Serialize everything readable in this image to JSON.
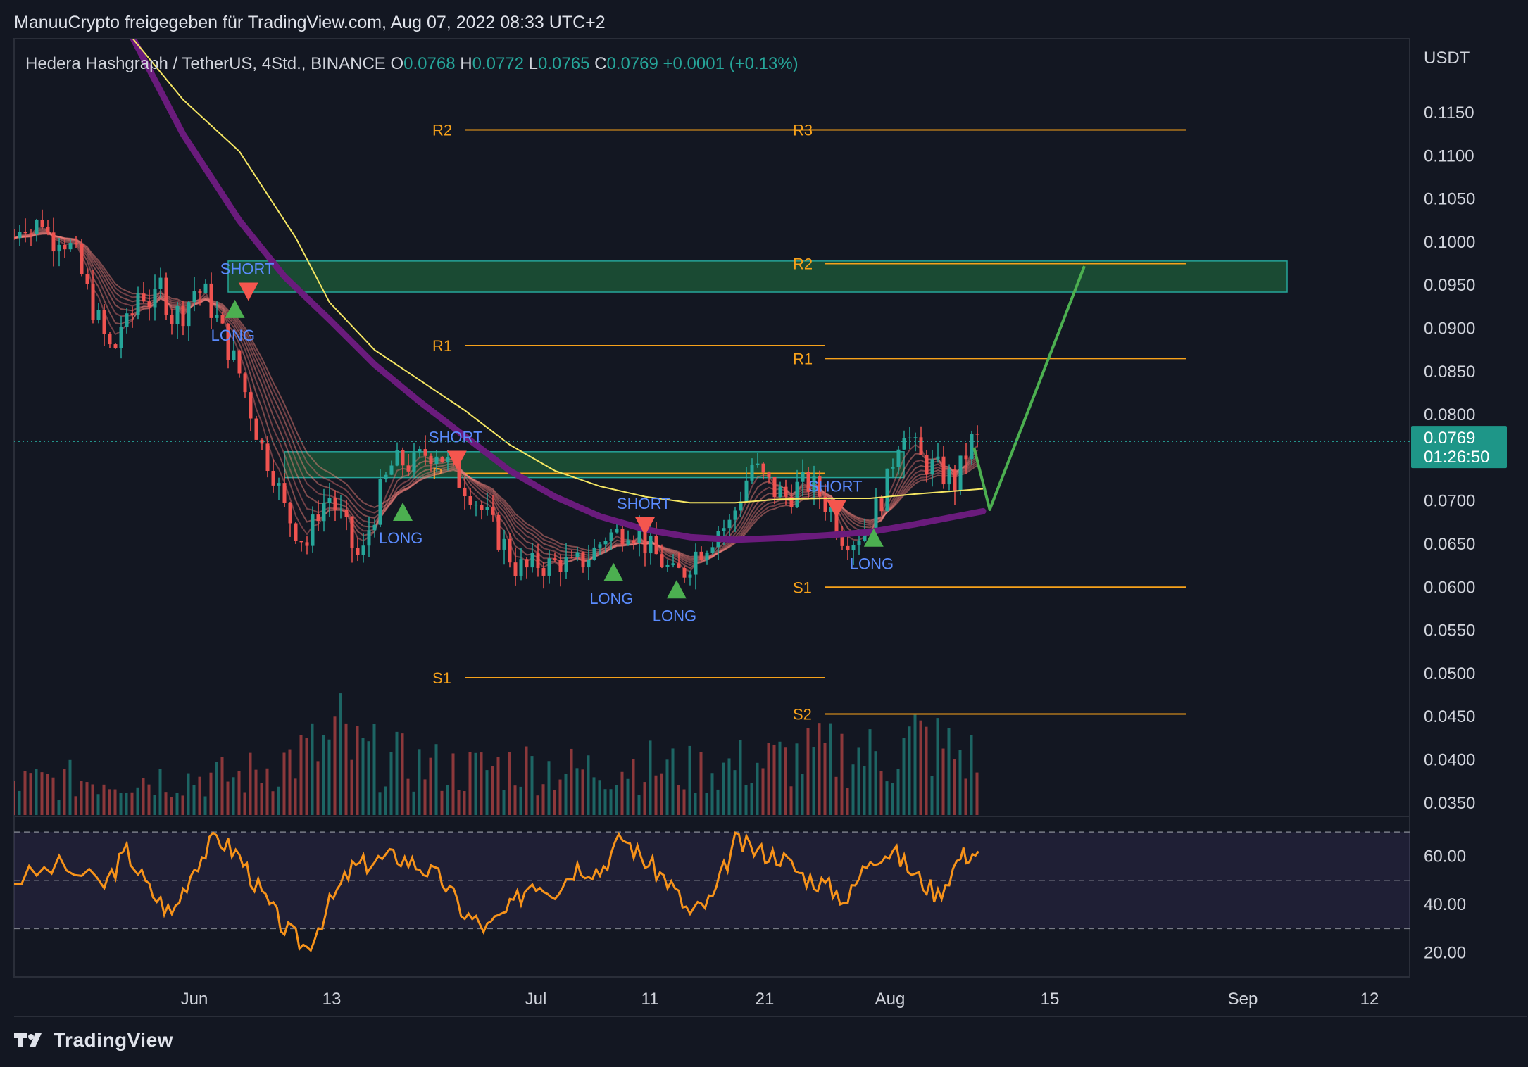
{
  "header": {
    "attribution": "ManuuCrypto freigegeben für TradingView.com, Aug 07, 2022 08:33 UTC+2"
  },
  "legend": {
    "symbol": "Hedera Hashgraph / TetherUS, 4Std., BINANCE",
    "o_key": "O",
    "o": "0.0768",
    "h_key": "H",
    "h": "0.0772",
    "l_key": "L",
    "l": "0.0765",
    "c_key": "C",
    "c": "0.0769",
    "change": "+0.0001 (+0.13%)"
  },
  "price_axis": {
    "currency": "USDT",
    "labels": [
      "0.1150",
      "0.1100",
      "0.1050",
      "0.1000",
      "0.0950",
      "0.0900",
      "0.0850",
      "0.0800",
      "0.0700",
      "0.0650",
      "0.0600",
      "0.0550",
      "0.0500",
      "0.0450",
      "0.0400",
      "0.0350"
    ],
    "current_price": "0.0769",
    "countdown": "01:26:50"
  },
  "rsi_axis": {
    "labels": [
      "60.00",
      "40.00",
      "20.00"
    ]
  },
  "time_axis": {
    "labels": [
      "Jun",
      "13",
      "Jul",
      "11",
      "21",
      "Aug",
      "15",
      "Sep",
      "12"
    ]
  },
  "colors": {
    "background": "#131722",
    "up": "#26a69a",
    "down": "#ef5350",
    "pivot": "#f7a21b",
    "zone": "#1e5c3a",
    "sma": "#f5e663",
    "ema": "#6a1b7c",
    "rsi": "#f7931a",
    "projection": "#4caf50",
    "signal_text": "#5b8cff"
  },
  "footer": {
    "brand": "TradingView",
    "logo_icon": "tradingview-logo-icon"
  },
  "chart_data": {
    "type": "candlestick",
    "symbol": "HBAR/USDT",
    "timeframe": "4Std.",
    "exchange": "BINANCE",
    "ylim": [
      0.0335,
      0.122
    ],
    "price_path": [
      [
        0.0,
        0.1005
      ],
      [
        0.8,
        0.103
      ],
      [
        1.6,
        0.101
      ],
      [
        2.4,
        0.103
      ],
      [
        3.2,
        0.1002
      ],
      [
        4.0,
        0.101
      ],
      [
        4.8,
        0.0998
      ],
      [
        5.6,
        0.0978
      ],
      [
        6.4,
        0.0945
      ],
      [
        7.2,
        0.0918
      ],
      [
        8.0,
        0.089
      ],
      [
        8.8,
        0.0868
      ],
      [
        9.5,
        0.0905
      ],
      [
        10.2,
        0.09
      ],
      [
        11.0,
        0.0942
      ],
      [
        11.6,
        0.094
      ],
      [
        12.4,
        0.0925
      ],
      [
        13.0,
        0.095
      ],
      [
        14.0,
        0.0915
      ],
      [
        15.0,
        0.092
      ],
      [
        16.0,
        0.0945
      ],
      [
        17.0,
        0.0938
      ],
      [
        18.0,
        0.091
      ],
      [
        19.0,
        0.0878
      ],
      [
        20.0,
        0.0848
      ],
      [
        21.0,
        0.0805
      ],
      [
        22.0,
        0.0762
      ],
      [
        23.0,
        0.0735
      ],
      [
        24.0,
        0.069
      ],
      [
        25.0,
        0.0668
      ],
      [
        26.0,
        0.065
      ],
      [
        27.0,
        0.069
      ],
      [
        28.0,
        0.0705
      ],
      [
        29.0,
        0.068
      ],
      [
        30.0,
        0.0648
      ],
      [
        30.8,
        0.0628
      ],
      [
        31.5,
        0.0668
      ],
      [
        32.5,
        0.0708
      ],
      [
        33.5,
        0.074
      ],
      [
        34.5,
        0.0745
      ],
      [
        35.5,
        0.0742
      ],
      [
        36.5,
        0.0755
      ],
      [
        37.5,
        0.076
      ],
      [
        38.5,
        0.0742
      ],
      [
        39.5,
        0.0725
      ],
      [
        40.5,
        0.0712
      ],
      [
        41.5,
        0.069
      ],
      [
        42.5,
        0.0668
      ],
      [
        43.5,
        0.0648
      ],
      [
        44.5,
        0.0625
      ],
      [
        45.5,
        0.062
      ],
      [
        46.5,
        0.0628
      ],
      [
        47.5,
        0.0625
      ],
      [
        48.5,
        0.063
      ],
      [
        49.5,
        0.0622
      ],
      [
        50.5,
        0.0632
      ],
      [
        51.5,
        0.0642
      ],
      [
        52.5,
        0.066
      ],
      [
        53.5,
        0.0662
      ],
      [
        54.5,
        0.0672
      ],
      [
        55.5,
        0.066
      ],
      [
        56.5,
        0.0642
      ],
      [
        57.5,
        0.063
      ],
      [
        58.5,
        0.0612
      ],
      [
        59.5,
        0.062
      ],
      [
        60.5,
        0.064
      ],
      [
        61.5,
        0.0652
      ],
      [
        62.5,
        0.0668
      ],
      [
        63.5,
        0.0672
      ],
      [
        64.5,
        0.0708
      ],
      [
        65.5,
        0.0742
      ],
      [
        66.5,
        0.0725
      ],
      [
        67.5,
        0.0712
      ],
      [
        68.5,
        0.0705
      ],
      [
        69.5,
        0.0715
      ],
      [
        70.5,
        0.072
      ],
      [
        71.5,
        0.0708
      ],
      [
        72.5,
        0.069
      ],
      [
        73.5,
        0.0662
      ],
      [
        74.5,
        0.0658
      ],
      [
        75.5,
        0.0668
      ],
      [
        76.5,
        0.069
      ],
      [
        77.5,
        0.072
      ],
      [
        78.2,
        0.076
      ],
      [
        78.9,
        0.079
      ],
      [
        79.6,
        0.0768
      ],
      [
        80.4,
        0.0748
      ],
      [
        81.2,
        0.0742
      ],
      [
        82.0,
        0.0735
      ],
      [
        82.8,
        0.0728
      ],
      [
        83.6,
        0.072
      ],
      [
        84.2,
        0.0745
      ],
      [
        84.8,
        0.0765
      ],
      [
        85.2,
        0.0772
      ],
      [
        85.6,
        0.0769
      ]
    ],
    "volume_profile": [
      [
        0,
        0.025
      ],
      [
        10,
        0.03
      ],
      [
        20,
        0.03
      ],
      [
        28,
        0.055
      ],
      [
        29,
        0.065
      ],
      [
        30,
        0.05
      ],
      [
        35,
        0.04
      ],
      [
        40,
        0.035
      ],
      [
        45,
        0.04
      ],
      [
        50,
        0.035
      ],
      [
        55,
        0.04
      ],
      [
        60,
        0.035
      ],
      [
        65,
        0.04
      ],
      [
        70,
        0.045
      ],
      [
        74,
        0.05
      ],
      [
        78,
        0.045
      ],
      [
        80,
        0.06
      ],
      [
        85,
        0.045
      ]
    ],
    "pivot_levels": [
      {
        "label": "R2",
        "value": 0.113,
        "x_start": 40,
        "x_end": 72
      },
      {
        "label": "R1",
        "value": 0.088,
        "x_start": 40,
        "x_end": 72
      },
      {
        "label": "P",
        "value": 0.0732,
        "x_start": 40,
        "x_end": 72
      },
      {
        "label": "S1",
        "value": 0.0495,
        "x_start": 40,
        "x_end": 72
      },
      {
        "label": "R3",
        "value": 0.113,
        "x_start": 72,
        "x_end": 104
      },
      {
        "label": "R2",
        "value": 0.0975,
        "x_start": 72,
        "x_end": 104
      },
      {
        "label": "R1",
        "value": 0.0865,
        "x_start": 72,
        "x_end": 104
      },
      {
        "label": "S1",
        "value": 0.06,
        "x_start": 72,
        "x_end": 104
      },
      {
        "label": "S2",
        "value": 0.0453,
        "x_start": 72,
        "x_end": 104
      }
    ],
    "zones": [
      {
        "low": 0.0942,
        "high": 0.0978,
        "x_start": 19,
        "x_end": 113
      },
      {
        "low": 0.0727,
        "high": 0.0757,
        "x_start": 24,
        "x_end": 79
      }
    ],
    "sma_path": [
      [
        9,
        0.126
      ],
      [
        15,
        0.1165
      ],
      [
        20,
        0.1105
      ],
      [
        25,
        0.1005
      ],
      [
        28,
        0.093
      ],
      [
        32,
        0.0875
      ],
      [
        36,
        0.084
      ],
      [
        40,
        0.0805
      ],
      [
        44,
        0.0765
      ],
      [
        48,
        0.0735
      ],
      [
        52,
        0.0717
      ],
      [
        56,
        0.0705
      ],
      [
        60,
        0.0698
      ],
      [
        64,
        0.0698
      ],
      [
        68,
        0.0702
      ],
      [
        72,
        0.0703
      ],
      [
        76,
        0.0703
      ],
      [
        80,
        0.0708
      ],
      [
        84,
        0.0712
      ],
      [
        86,
        0.0714
      ]
    ],
    "ema_path": [
      [
        10,
        0.125
      ],
      [
        15,
        0.1125
      ],
      [
        20,
        0.1025
      ],
      [
        24,
        0.096
      ],
      [
        28,
        0.091
      ],
      [
        32,
        0.0858
      ],
      [
        36,
        0.0815
      ],
      [
        40,
        0.0775
      ],
      [
        44,
        0.0735
      ],
      [
        48,
        0.0705
      ],
      [
        52,
        0.0682
      ],
      [
        56,
        0.0667
      ],
      [
        60,
        0.0658
      ],
      [
        64,
        0.0655
      ],
      [
        68,
        0.0657
      ],
      [
        72,
        0.066
      ],
      [
        76,
        0.0664
      ],
      [
        80,
        0.0673
      ],
      [
        84,
        0.0683
      ],
      [
        86,
        0.0688
      ]
    ],
    "projection": [
      [
        85.2,
        0.0762
      ],
      [
        86.6,
        0.069
      ],
      [
        95.0,
        0.0972
      ]
    ],
    "signals": [
      {
        "type": "SHORT",
        "x": 20.8,
        "price": 0.094
      },
      {
        "type": "LONG",
        "x": 19.6,
        "price": 0.0925
      },
      {
        "type": "LONG",
        "x": 34.5,
        "price": 0.069
      },
      {
        "type": "SHORT",
        "x": 39.3,
        "price": 0.0745
      },
      {
        "type": "SHORT",
        "x": 56.0,
        "price": 0.0668
      },
      {
        "type": "LONG",
        "x": 53.2,
        "price": 0.062
      },
      {
        "type": "LONG",
        "x": 58.8,
        "price": 0.06
      },
      {
        "type": "SHORT",
        "x": 73.0,
        "price": 0.0688
      },
      {
        "type": "LONG",
        "x": 76.3,
        "price": 0.066
      }
    ],
    "rsi": {
      "ylim": [
        10,
        75
      ],
      "levels": [
        70,
        50,
        30
      ],
      "path": [
        [
          0,
          50
        ],
        [
          4,
          56
        ],
        [
          8,
          48
        ],
        [
          10,
          62
        ],
        [
          12,
          46
        ],
        [
          14,
          36
        ],
        [
          16,
          56
        ],
        [
          18,
          68
        ],
        [
          20,
          60
        ],
        [
          22,
          44
        ],
        [
          24,
          30
        ],
        [
          26,
          22
        ],
        [
          28,
          40
        ],
        [
          30,
          55
        ],
        [
          32,
          58
        ],
        [
          34,
          60
        ],
        [
          36,
          56
        ],
        [
          38,
          50
        ],
        [
          40,
          36
        ],
        [
          42,
          30
        ],
        [
          44,
          38
        ],
        [
          46,
          50
        ],
        [
          48,
          46
        ],
        [
          50,
          56
        ],
        [
          52,
          54
        ],
        [
          54,
          68
        ],
        [
          56,
          58
        ],
        [
          58,
          50
        ],
        [
          60,
          36
        ],
        [
          62,
          42
        ],
        [
          64,
          66
        ],
        [
          66,
          62
        ],
        [
          68,
          60
        ],
        [
          70,
          52
        ],
        [
          72,
          48
        ],
        [
          74,
          42
        ],
        [
          76,
          60
        ],
        [
          78,
          62
        ],
        [
          80,
          52
        ],
        [
          82,
          44
        ],
        [
          84,
          60
        ],
        [
          85.6,
          62
        ]
      ]
    }
  }
}
